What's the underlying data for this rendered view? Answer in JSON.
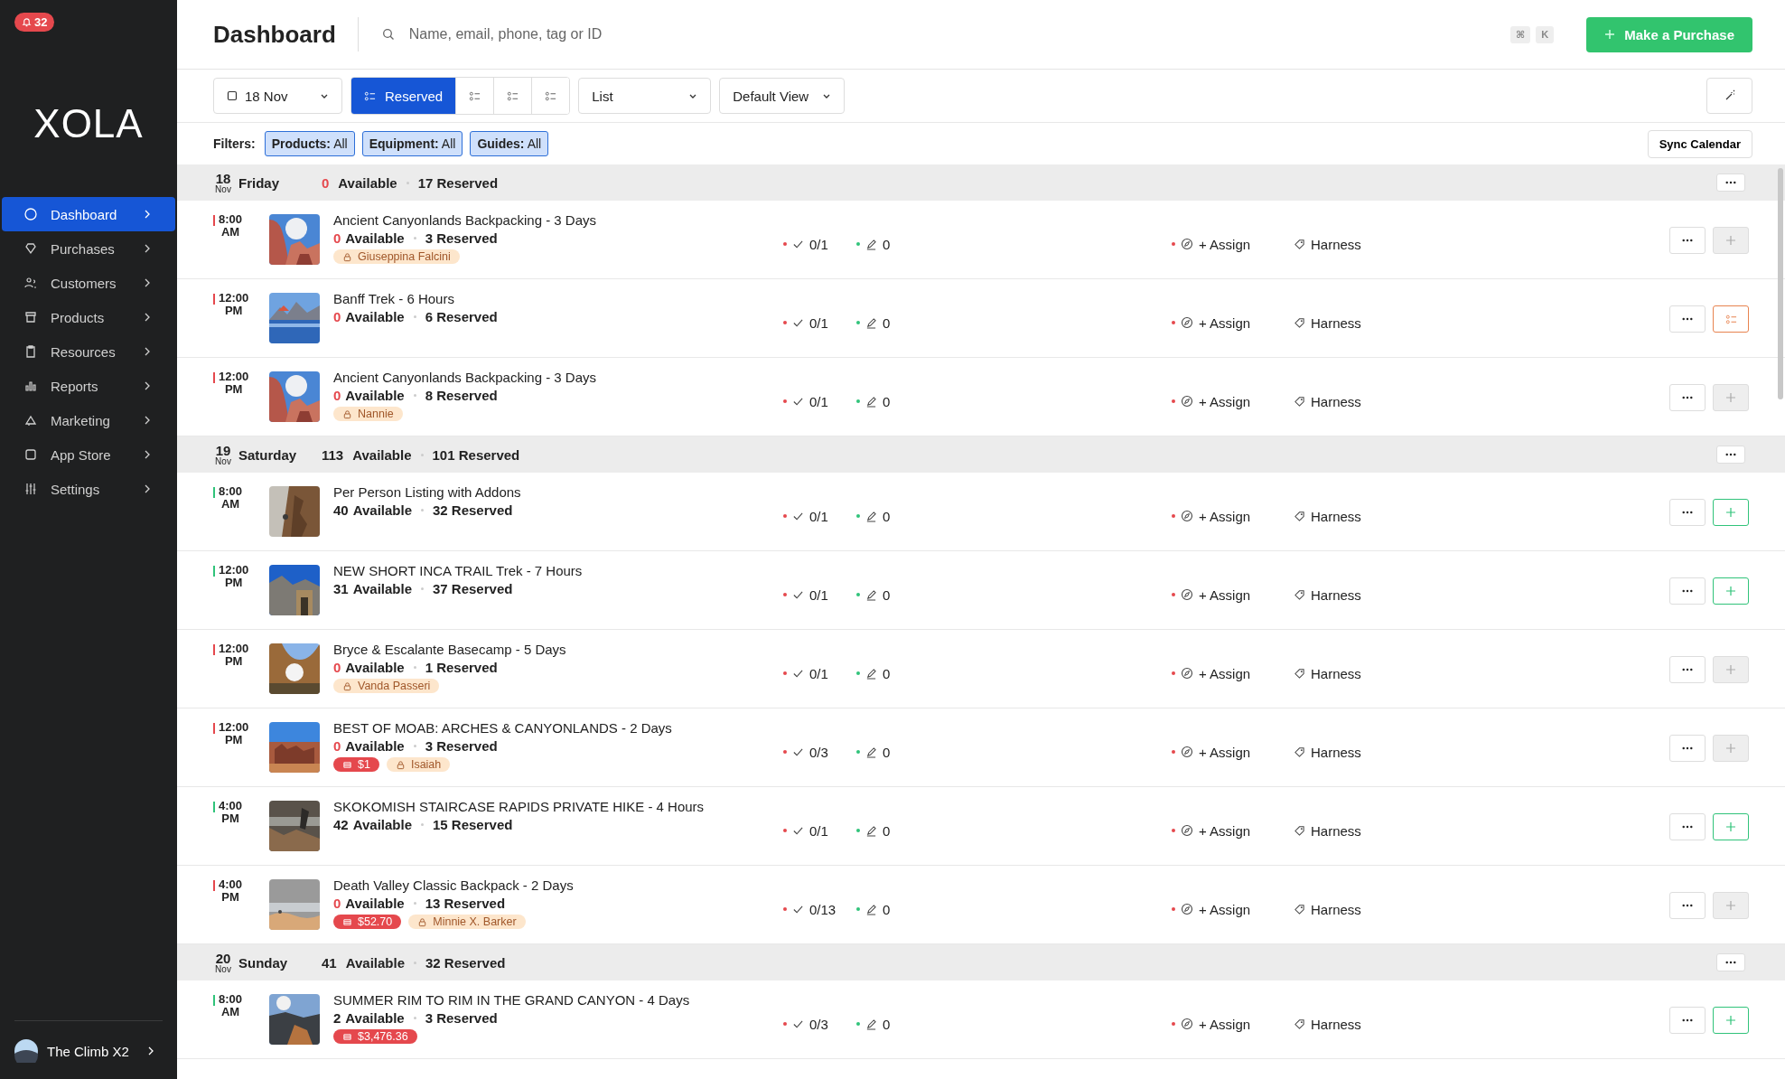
{
  "notifications": {
    "count": "32"
  },
  "logo": "XOLA",
  "sidebar": {
    "items": [
      {
        "label": "Dashboard",
        "selected": true
      },
      {
        "label": "Purchases",
        "selected": false
      },
      {
        "label": "Customers",
        "selected": false
      },
      {
        "label": "Products",
        "selected": false
      },
      {
        "label": "Resources",
        "selected": false
      },
      {
        "label": "Reports",
        "selected": false
      },
      {
        "label": "Marketing",
        "selected": false
      },
      {
        "label": "App Store",
        "selected": false
      },
      {
        "label": "Settings",
        "selected": false
      }
    ],
    "account": "The Climb X2"
  },
  "header": {
    "title": "Dashboard",
    "search": {
      "placeholder": "Name, email, phone, tag or ID"
    },
    "shortcut": [
      "⌘",
      "K"
    ],
    "primary_button": "Make a Purchase"
  },
  "toolbar": {
    "date": "18 Nov",
    "views": [
      {
        "label": "Reserved",
        "selected": true
      },
      {
        "selected": false
      },
      {
        "selected": false
      },
      {
        "selected": false
      }
    ],
    "layout": "List",
    "saved_view": "Default View"
  },
  "filters": {
    "label": "Filters:",
    "chips": [
      {
        "name": "Products:",
        "value": "All"
      },
      {
        "name": "Equipment:",
        "value": "All"
      },
      {
        "name": "Guides:",
        "value": "All"
      }
    ],
    "sync_button": "Sync Calendar"
  },
  "days": [
    {
      "day": "18",
      "month": "Nov",
      "weekday": "Friday",
      "available": "0",
      "available_label": "Available",
      "sold_out": true,
      "reserved": "17 Reserved",
      "events": [
        {
          "time": "8:00",
          "period": "AM",
          "color": "#e5484d",
          "title": "Ancient Canyonlands Backpacking - 3 Days",
          "available": "0",
          "available_label": "Available",
          "sold_out": true,
          "reserved": "3 Reserved",
          "tags": [
            {
              "kind": "guide",
              "label": "Giuseppina Falcini"
            }
          ],
          "checkins": "0/1",
          "notes": "0",
          "assign": "+ Assign",
          "equipment": "Harness",
          "action": {
            "kind": "disabled"
          }
        },
        {
          "time": "12:00",
          "period": "PM",
          "color": "#e5484d",
          "title": "Banff Trek - 6 Hours",
          "available": "0",
          "available_label": "Available",
          "sold_out": true,
          "reserved": "6 Reserved",
          "checkins": "0/1",
          "notes": "0",
          "assign": "+ Assign",
          "equipment": "Harness",
          "action": {
            "kind": "warning"
          }
        },
        {
          "time": "12:00",
          "period": "PM",
          "color": "#e5484d",
          "title": "Ancient Canyonlands Backpacking - 3 Days",
          "available": "0",
          "available_label": "Available",
          "sold_out": true,
          "reserved": "8 Reserved",
          "tags": [
            {
              "kind": "guide",
              "label": "Nannie"
            }
          ],
          "checkins": "0/1",
          "notes": "0",
          "assign": "+ Assign",
          "equipment": "Harness",
          "action": {
            "kind": "disabled"
          }
        }
      ]
    },
    {
      "day": "19",
      "month": "Nov",
      "weekday": "Saturday",
      "available": "113",
      "available_label": "Available",
      "sold_out": false,
      "reserved": "101 Reserved",
      "events": [
        {
          "time": "8:00",
          "period": "AM",
          "color": "#30c37a",
          "title": "Per Person Listing with Addons",
          "available": "40",
          "available_label": "Available",
          "sold_out": false,
          "reserved": "32 Reserved",
          "checkins": "0/1",
          "notes": "0",
          "assign": "+ Assign",
          "equipment": "Harness",
          "action": {
            "kind": "add"
          }
        },
        {
          "time": "12:00",
          "period": "PM",
          "color": "#30c37a",
          "title": "NEW SHORT INCA TRAIL Trek - 7 Hours",
          "available": "31",
          "available_label": "Available",
          "sold_out": false,
          "reserved": "37 Reserved",
          "checkins": "0/1",
          "notes": "0",
          "assign": "+ Assign",
          "equipment": "Harness",
          "action": {
            "kind": "add"
          }
        },
        {
          "time": "12:00",
          "period": "PM",
          "color": "#e5484d",
          "title": "Bryce & Escalante Basecamp - 5 Days",
          "available": "0",
          "available_label": "Available",
          "sold_out": true,
          "reserved": "1 Reserved",
          "tags": [
            {
              "kind": "guide",
              "label": "Vanda Passeri"
            }
          ],
          "checkins": "0/1",
          "notes": "0",
          "assign": "+ Assign",
          "equipment": "Harness",
          "action": {
            "kind": "disabled"
          }
        },
        {
          "time": "12:00",
          "period": "PM",
          "color": "#e5484d",
          "title": "BEST OF MOAB: ARCHES & CANYONLANDS - 2 Days",
          "available": "0",
          "available_label": "Available",
          "sold_out": true,
          "reserved": "3 Reserved",
          "tags": [
            {
              "kind": "payment",
              "label": "$1"
            },
            {
              "kind": "guide",
              "label": "Isaiah"
            }
          ],
          "checkins": "0/3",
          "notes": "0",
          "assign": "+ Assign",
          "equipment": "Harness",
          "action": {
            "kind": "disabled"
          }
        },
        {
          "time": "4:00",
          "period": "PM",
          "color": "#30c37a",
          "title": "SKOKOMISH STAIRCASE RAPIDS PRIVATE HIKE - 4 Hours",
          "available": "42",
          "available_label": "Available",
          "sold_out": false,
          "reserved": "15 Reserved",
          "checkins": "0/1",
          "notes": "0",
          "assign": "+ Assign",
          "equipment": "Harness",
          "action": {
            "kind": "add"
          }
        },
        {
          "time": "4:00",
          "period": "PM",
          "color": "#e5484d",
          "title": "Death Valley Classic Backpack - 2 Days",
          "available": "0",
          "available_label": "Available",
          "sold_out": true,
          "reserved": "13 Reserved",
          "tags": [
            {
              "kind": "payment",
              "label": "$52.70"
            },
            {
              "kind": "guide",
              "label": "Minnie X. Barker"
            }
          ],
          "checkins": "0/13",
          "notes": "0",
          "assign": "+ Assign",
          "equipment": "Harness",
          "action": {
            "kind": "disabled"
          }
        }
      ]
    },
    {
      "day": "20",
      "month": "Nov",
      "weekday": "Sunday",
      "available": "41",
      "available_label": "Available",
      "sold_out": false,
      "reserved": "32 Reserved",
      "events": [
        {
          "time": "8:00",
          "period": "AM",
          "color": "#30c37a",
          "title": "SUMMER RIM TO RIM IN THE GRAND CANYON - 4 Days",
          "available": "2",
          "available_label": "Available",
          "sold_out": false,
          "reserved": "3 Reserved",
          "tags": [
            {
              "kind": "payment",
              "label": "$3,476.36"
            }
          ],
          "checkins": "0/3",
          "notes": "0",
          "assign": "+ Assign",
          "equipment": "Harness",
          "action": {
            "kind": "add"
          }
        }
      ]
    }
  ]
}
